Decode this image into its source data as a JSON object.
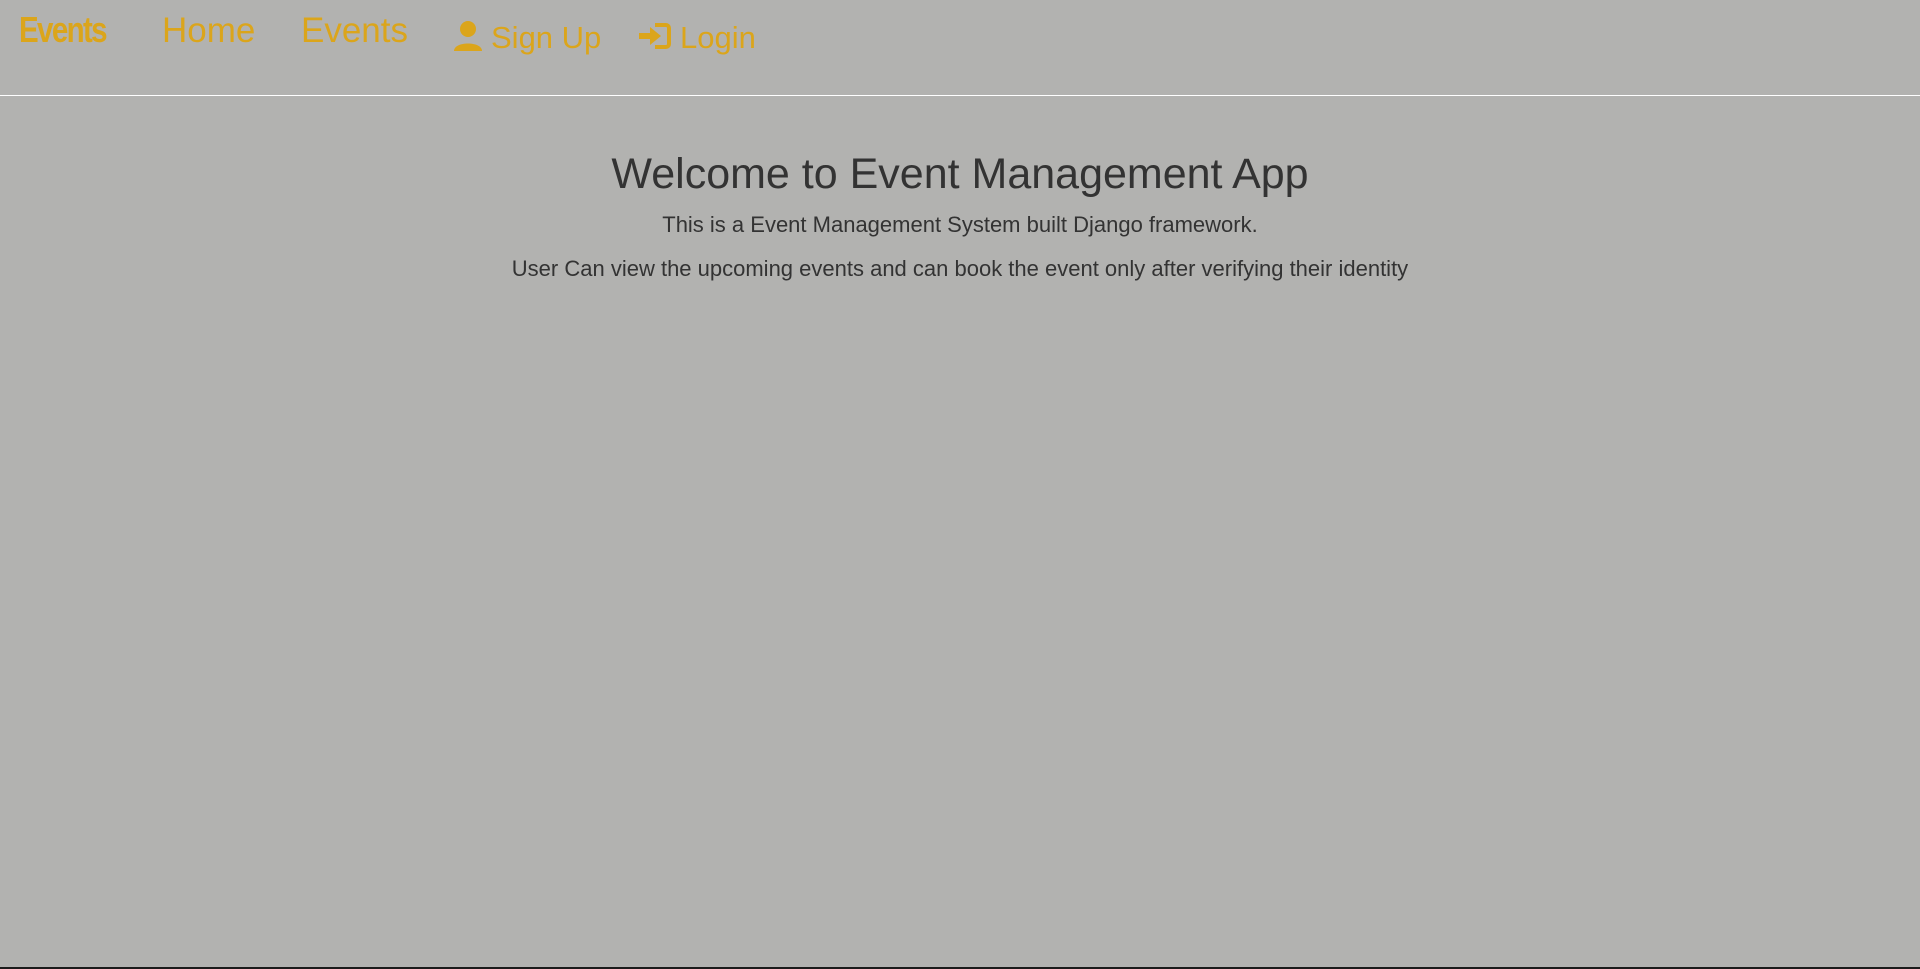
{
  "nav": {
    "brand": "Events",
    "home": "Home",
    "events": "Events",
    "signup": "Sign Up",
    "login": "Login",
    "signup_icon": "user-icon",
    "login_icon": "log-in-icon",
    "accent_color": "#dba51b"
  },
  "main": {
    "title": "Welcome to Event Management App",
    "description_1": "This is a Event Management System built Django framework.",
    "description_2": "User Can view the upcoming events and can book the event only after verifying their identity"
  },
  "theme": {
    "background": "#b2b2b0",
    "text": "#333333"
  }
}
